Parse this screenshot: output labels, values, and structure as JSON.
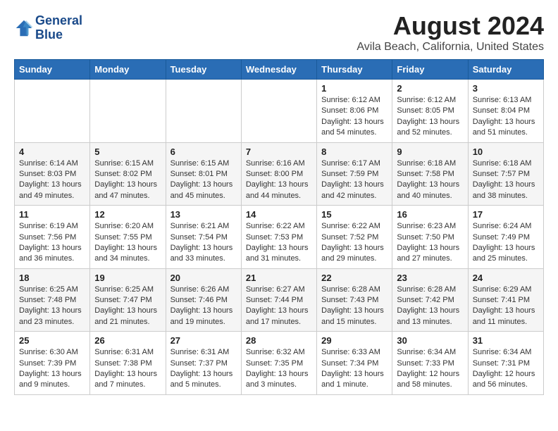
{
  "header": {
    "logo_line1": "General",
    "logo_line2": "Blue",
    "main_title": "August 2024",
    "subtitle": "Avila Beach, California, United States"
  },
  "calendar": {
    "days_of_week": [
      "Sunday",
      "Monday",
      "Tuesday",
      "Wednesday",
      "Thursday",
      "Friday",
      "Saturday"
    ],
    "weeks": [
      [
        {
          "day": "",
          "info": ""
        },
        {
          "day": "",
          "info": ""
        },
        {
          "day": "",
          "info": ""
        },
        {
          "day": "",
          "info": ""
        },
        {
          "day": "1",
          "info": "Sunrise: 6:12 AM\nSunset: 8:06 PM\nDaylight: 13 hours\nand 54 minutes."
        },
        {
          "day": "2",
          "info": "Sunrise: 6:12 AM\nSunset: 8:05 PM\nDaylight: 13 hours\nand 52 minutes."
        },
        {
          "day": "3",
          "info": "Sunrise: 6:13 AM\nSunset: 8:04 PM\nDaylight: 13 hours\nand 51 minutes."
        }
      ],
      [
        {
          "day": "4",
          "info": "Sunrise: 6:14 AM\nSunset: 8:03 PM\nDaylight: 13 hours\nand 49 minutes."
        },
        {
          "day": "5",
          "info": "Sunrise: 6:15 AM\nSunset: 8:02 PM\nDaylight: 13 hours\nand 47 minutes."
        },
        {
          "day": "6",
          "info": "Sunrise: 6:15 AM\nSunset: 8:01 PM\nDaylight: 13 hours\nand 45 minutes."
        },
        {
          "day": "7",
          "info": "Sunrise: 6:16 AM\nSunset: 8:00 PM\nDaylight: 13 hours\nand 44 minutes."
        },
        {
          "day": "8",
          "info": "Sunrise: 6:17 AM\nSunset: 7:59 PM\nDaylight: 13 hours\nand 42 minutes."
        },
        {
          "day": "9",
          "info": "Sunrise: 6:18 AM\nSunset: 7:58 PM\nDaylight: 13 hours\nand 40 minutes."
        },
        {
          "day": "10",
          "info": "Sunrise: 6:18 AM\nSunset: 7:57 PM\nDaylight: 13 hours\nand 38 minutes."
        }
      ],
      [
        {
          "day": "11",
          "info": "Sunrise: 6:19 AM\nSunset: 7:56 PM\nDaylight: 13 hours\nand 36 minutes."
        },
        {
          "day": "12",
          "info": "Sunrise: 6:20 AM\nSunset: 7:55 PM\nDaylight: 13 hours\nand 34 minutes."
        },
        {
          "day": "13",
          "info": "Sunrise: 6:21 AM\nSunset: 7:54 PM\nDaylight: 13 hours\nand 33 minutes."
        },
        {
          "day": "14",
          "info": "Sunrise: 6:22 AM\nSunset: 7:53 PM\nDaylight: 13 hours\nand 31 minutes."
        },
        {
          "day": "15",
          "info": "Sunrise: 6:22 AM\nSunset: 7:52 PM\nDaylight: 13 hours\nand 29 minutes."
        },
        {
          "day": "16",
          "info": "Sunrise: 6:23 AM\nSunset: 7:50 PM\nDaylight: 13 hours\nand 27 minutes."
        },
        {
          "day": "17",
          "info": "Sunrise: 6:24 AM\nSunset: 7:49 PM\nDaylight: 13 hours\nand 25 minutes."
        }
      ],
      [
        {
          "day": "18",
          "info": "Sunrise: 6:25 AM\nSunset: 7:48 PM\nDaylight: 13 hours\nand 23 minutes."
        },
        {
          "day": "19",
          "info": "Sunrise: 6:25 AM\nSunset: 7:47 PM\nDaylight: 13 hours\nand 21 minutes."
        },
        {
          "day": "20",
          "info": "Sunrise: 6:26 AM\nSunset: 7:46 PM\nDaylight: 13 hours\nand 19 minutes."
        },
        {
          "day": "21",
          "info": "Sunrise: 6:27 AM\nSunset: 7:44 PM\nDaylight: 13 hours\nand 17 minutes."
        },
        {
          "day": "22",
          "info": "Sunrise: 6:28 AM\nSunset: 7:43 PM\nDaylight: 13 hours\nand 15 minutes."
        },
        {
          "day": "23",
          "info": "Sunrise: 6:28 AM\nSunset: 7:42 PM\nDaylight: 13 hours\nand 13 minutes."
        },
        {
          "day": "24",
          "info": "Sunrise: 6:29 AM\nSunset: 7:41 PM\nDaylight: 13 hours\nand 11 minutes."
        }
      ],
      [
        {
          "day": "25",
          "info": "Sunrise: 6:30 AM\nSunset: 7:39 PM\nDaylight: 13 hours\nand 9 minutes."
        },
        {
          "day": "26",
          "info": "Sunrise: 6:31 AM\nSunset: 7:38 PM\nDaylight: 13 hours\nand 7 minutes."
        },
        {
          "day": "27",
          "info": "Sunrise: 6:31 AM\nSunset: 7:37 PM\nDaylight: 13 hours\nand 5 minutes."
        },
        {
          "day": "28",
          "info": "Sunrise: 6:32 AM\nSunset: 7:35 PM\nDaylight: 13 hours\nand 3 minutes."
        },
        {
          "day": "29",
          "info": "Sunrise: 6:33 AM\nSunset: 7:34 PM\nDaylight: 13 hours\nand 1 minute."
        },
        {
          "day": "30",
          "info": "Sunrise: 6:34 AM\nSunset: 7:33 PM\nDaylight: 12 hours\nand 58 minutes."
        },
        {
          "day": "31",
          "info": "Sunrise: 6:34 AM\nSunset: 7:31 PM\nDaylight: 12 hours\nand 56 minutes."
        }
      ]
    ]
  }
}
